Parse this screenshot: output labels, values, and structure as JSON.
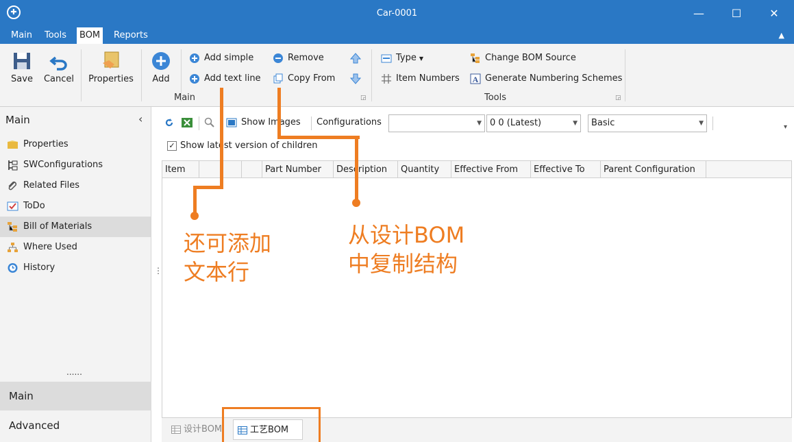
{
  "window": {
    "title": "Car-0001",
    "minimize": "—",
    "maximize": "☐",
    "close": "✕"
  },
  "menu": {
    "items": [
      "Main",
      "Tools",
      "BOM",
      "Reports"
    ],
    "active": "BOM",
    "collapse": "▲"
  },
  "ribbon": {
    "save": "Save",
    "cancel": "Cancel",
    "properties": "Properties",
    "add": "Add",
    "add_simple": "Add simple",
    "add_text_line": "Add text line",
    "remove": "Remove",
    "copy_from": "Copy From",
    "type": "Type",
    "item_numbers": "Item Numbers",
    "change_bom_source": "Change BOM Source",
    "generate_numbering": "Generate Numbering Schemes",
    "group_main": "Main",
    "group_tools": "Tools",
    "launcher": "◲"
  },
  "left_pane": {
    "title": "Main",
    "collapse": "‹",
    "items": [
      "Properties",
      "SWConfigurations",
      "Related Files",
      "ToDo",
      "Bill of Materials",
      "Where Used",
      "History"
    ],
    "selected": "Bill of Materials",
    "dots": "......",
    "bottom_buttons": [
      "Main",
      "Advanced"
    ],
    "splitter": "⋮"
  },
  "toolbar": {
    "show_images": "Show Images",
    "configurations": "Configurations",
    "config_value": "",
    "version_value": "0 0 (Latest)",
    "view_value": "Basic",
    "show_latest_label": "Show latest version of children",
    "show_latest_checked": true
  },
  "grid": {
    "columns": [
      "Item",
      "",
      "",
      "",
      "Part Number",
      "Description",
      "Quantity",
      "Effective From",
      "Effective To",
      "Parent Configuration"
    ]
  },
  "bottom_tabs": [
    "设计BOM",
    "工艺BOM"
  ],
  "annotations": {
    "left_line1": "还可添加",
    "left_line2": "文本行",
    "right_line1": "从设计BOM",
    "right_line2": "中复制结构"
  },
  "colors": {
    "accent": "#2a78c5",
    "annotation": "#ee7d22"
  }
}
